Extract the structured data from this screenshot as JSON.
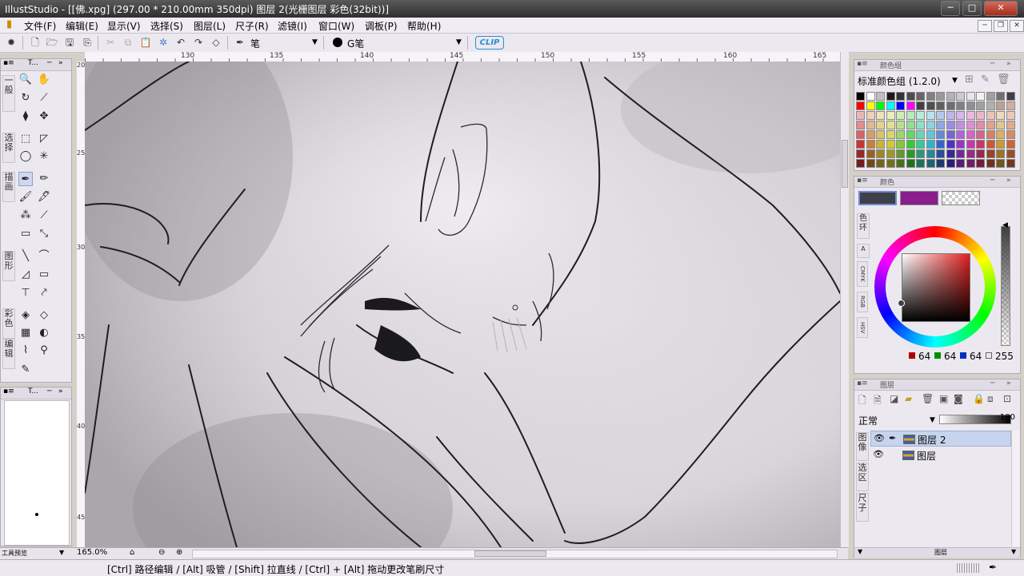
{
  "window": {
    "title": "IllustStudio - [[佛.xpg] (297.00 * 210.00mm 350dpi)   图层 2(光栅图层 彩色(32bit))]",
    "app_icon": "app-icon",
    "buttons": {
      "minimize": "─",
      "maximize": "□",
      "close": "✕"
    }
  },
  "menu": [
    {
      "id": "file",
      "label": "文件(F)"
    },
    {
      "id": "edit",
      "label": "编辑(E)"
    },
    {
      "id": "view",
      "label": "显示(V)"
    },
    {
      "id": "select",
      "label": "选择(S)"
    },
    {
      "id": "layer",
      "label": "图层(L)"
    },
    {
      "id": "ruler",
      "label": "尺子(R)"
    },
    {
      "id": "filter",
      "label": "滤镜(I)"
    },
    {
      "id": "window",
      "label": "窗口(W)"
    },
    {
      "id": "palette",
      "label": "调板(P)"
    },
    {
      "id": "help",
      "label": "帮助(H)"
    }
  ],
  "toolbar": {
    "brush_name": "笔",
    "brush_preset": "G笔",
    "clip_label": "CLIP"
  },
  "ruler": {
    "top_labels": [
      "130",
      "135",
      "140",
      "145",
      "150",
      "155",
      "160",
      "165"
    ],
    "left_labels": [
      "20",
      "25",
      "30",
      "35",
      "40",
      "45"
    ]
  },
  "tools_panel": {
    "header": "T... ",
    "categories": [
      "一般",
      "选择",
      "描画",
      "图形",
      "彩色",
      "编辑"
    ]
  },
  "subtool_panel": {
    "header": "T... "
  },
  "canvas_status": {
    "zoom": "165.0%",
    "footer_label": "工具预览"
  },
  "color_set_panel": {
    "title": "颜色组",
    "set_name": "标准颜色组 (1.2.0)"
  },
  "color_panel": {
    "title": "颜色",
    "tabs": [
      "色环",
      "A",
      "CMYK",
      "RGB",
      "HSV"
    ],
    "main_color": "#3f3f4a",
    "sub_color": "#8a1e8c",
    "r": "64",
    "g": "64",
    "b": "64",
    "a": "255"
  },
  "layer_panel": {
    "title": "图层",
    "blend_mode": "正常",
    "opacity": "100",
    "side_tabs": [
      "图像",
      "选区",
      "尺子"
    ],
    "layers": [
      {
        "name": "图层 2",
        "selected": true
      },
      {
        "name": "图层",
        "selected": false
      }
    ],
    "footer_label": "图层"
  },
  "status": {
    "hint": "[Ctrl] 路径编辑 / [Alt] 吸管 / [Shift] 拉直线 / [Ctrl] + [Alt] 拖动更改笔刷尺寸"
  }
}
